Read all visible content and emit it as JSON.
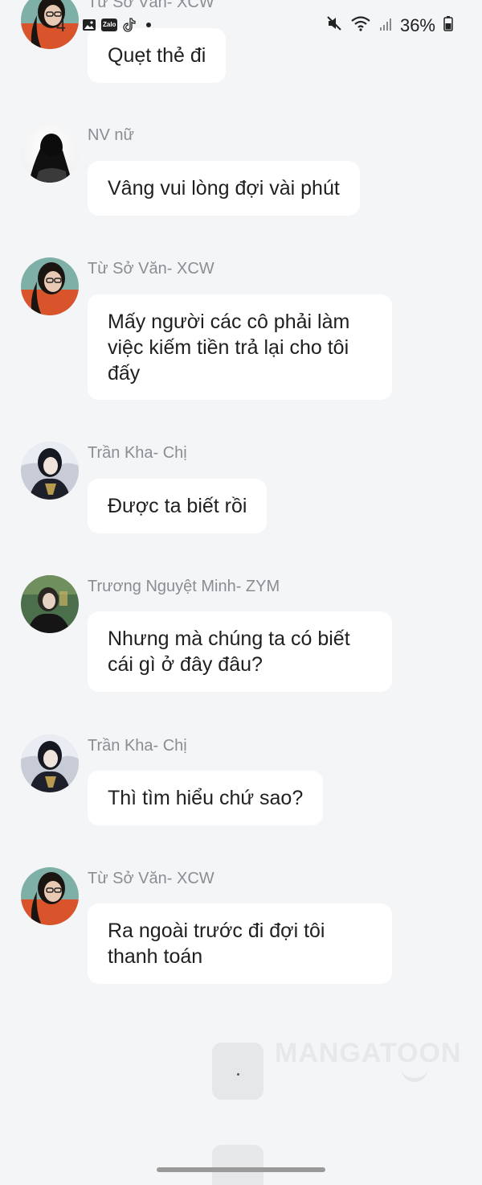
{
  "status_bar": {
    "time": "4",
    "battery": "36%",
    "icons": [
      "image-icon",
      "zalo-icon",
      "tiktok-icon",
      "dot-icon",
      "mute-icon",
      "wifi-icon",
      "signal-icon",
      "battery-icon"
    ],
    "zalo_label": "Zalo"
  },
  "messages": [
    {
      "sender": "Từ Sở Văn- XCW",
      "text": "Quẹt thẻ đi"
    },
    {
      "sender": "NV nữ",
      "text": "Vâng vui lòng đợi vài phút"
    },
    {
      "sender": "Từ Sở Văn- XCW",
      "text": "Mấy người các cô phải làm việc kiếm tiền trả lại cho tôi đấy"
    },
    {
      "sender": "Trần Kha- Chị",
      "text": "Được ta biết rồi"
    },
    {
      "sender": "Trương Nguyệt Minh- ZYM",
      "text": "Nhưng mà chúng ta có biết cái gì ở đây đâu?"
    },
    {
      "sender": "Trần Kha- Chị",
      "text": "Thì tìm hiểu chứ sao?"
    },
    {
      "sender": "Từ Sở Văn- XCW",
      "text": "Ra ngoài trước đi đợi tôi thanh toán"
    }
  ],
  "typing": {
    "text": "."
  },
  "watermark": "MANGATOON",
  "colors": {
    "background": "#f4f5f7",
    "bubble": "#ffffff",
    "sender": "#8a8d93"
  }
}
